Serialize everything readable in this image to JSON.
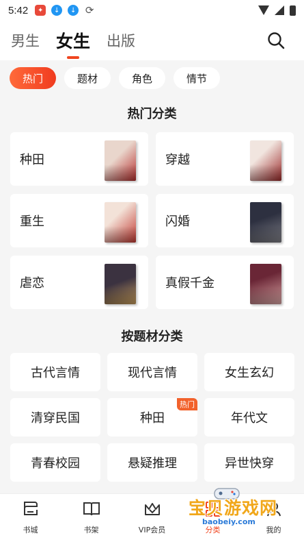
{
  "status_bar": {
    "time": "5:42",
    "icons": [
      "app-icon",
      "download-icon",
      "download-icon",
      "sync-icon"
    ],
    "right_icons": [
      "wifi-icon",
      "signal-icon",
      "battery-icon"
    ]
  },
  "top_tabs": [
    {
      "label": "男生",
      "active": false
    },
    {
      "label": "女生",
      "active": true
    },
    {
      "label": "出版",
      "active": false
    }
  ],
  "chips": [
    {
      "label": "热门",
      "active": true
    },
    {
      "label": "题材",
      "active": false
    },
    {
      "label": "角色",
      "active": false
    },
    {
      "label": "情节",
      "active": false
    }
  ],
  "hot_section": {
    "title": "热门分类",
    "items": [
      {
        "label": "种田",
        "cover_colors": [
          "#e9d6cc",
          "#b7302f"
        ]
      },
      {
        "label": "穿越",
        "cover_colors": [
          "#f1e5df",
          "#9c2a2a"
        ]
      },
      {
        "label": "重生",
        "cover_colors": [
          "#f3e2d8",
          "#c23a32"
        ]
      },
      {
        "label": "闪婚",
        "cover_colors": [
          "#2d3040",
          "#7f7f86"
        ]
      },
      {
        "label": "虐恋",
        "cover_colors": [
          "#3b3240",
          "#c69c5c"
        ]
      },
      {
        "label": "真假千金",
        "cover_colors": [
          "#6a2636",
          "#d7a3a2"
        ]
      }
    ]
  },
  "theme_section": {
    "title": "按题材分类",
    "items": [
      {
        "label": "古代言情",
        "badge": ""
      },
      {
        "label": "现代言情",
        "badge": ""
      },
      {
        "label": "女生玄幻",
        "badge": ""
      },
      {
        "label": "清穿民国",
        "badge": ""
      },
      {
        "label": "种田",
        "badge": "热门"
      },
      {
        "label": "年代文",
        "badge": ""
      },
      {
        "label": "青春校园",
        "badge": ""
      },
      {
        "label": "悬疑推理",
        "badge": ""
      },
      {
        "label": "异世快穿",
        "badge": ""
      }
    ]
  },
  "bottom_nav": [
    {
      "label": "书城",
      "icon": "bookstore-icon"
    },
    {
      "label": "书架",
      "icon": "bookshelf-icon"
    },
    {
      "label": "VIP会员",
      "icon": "vip-crown-icon"
    },
    {
      "label": "分类",
      "icon": "category-icon"
    },
    {
      "label": "我的",
      "icon": "profile-icon"
    }
  ],
  "watermark": {
    "text": "宝贝游戏网",
    "sub": "baobeiy.com"
  },
  "colors": {
    "accent": "#f0451f",
    "badge": "#f2622c",
    "background": "#f5f5f5"
  }
}
